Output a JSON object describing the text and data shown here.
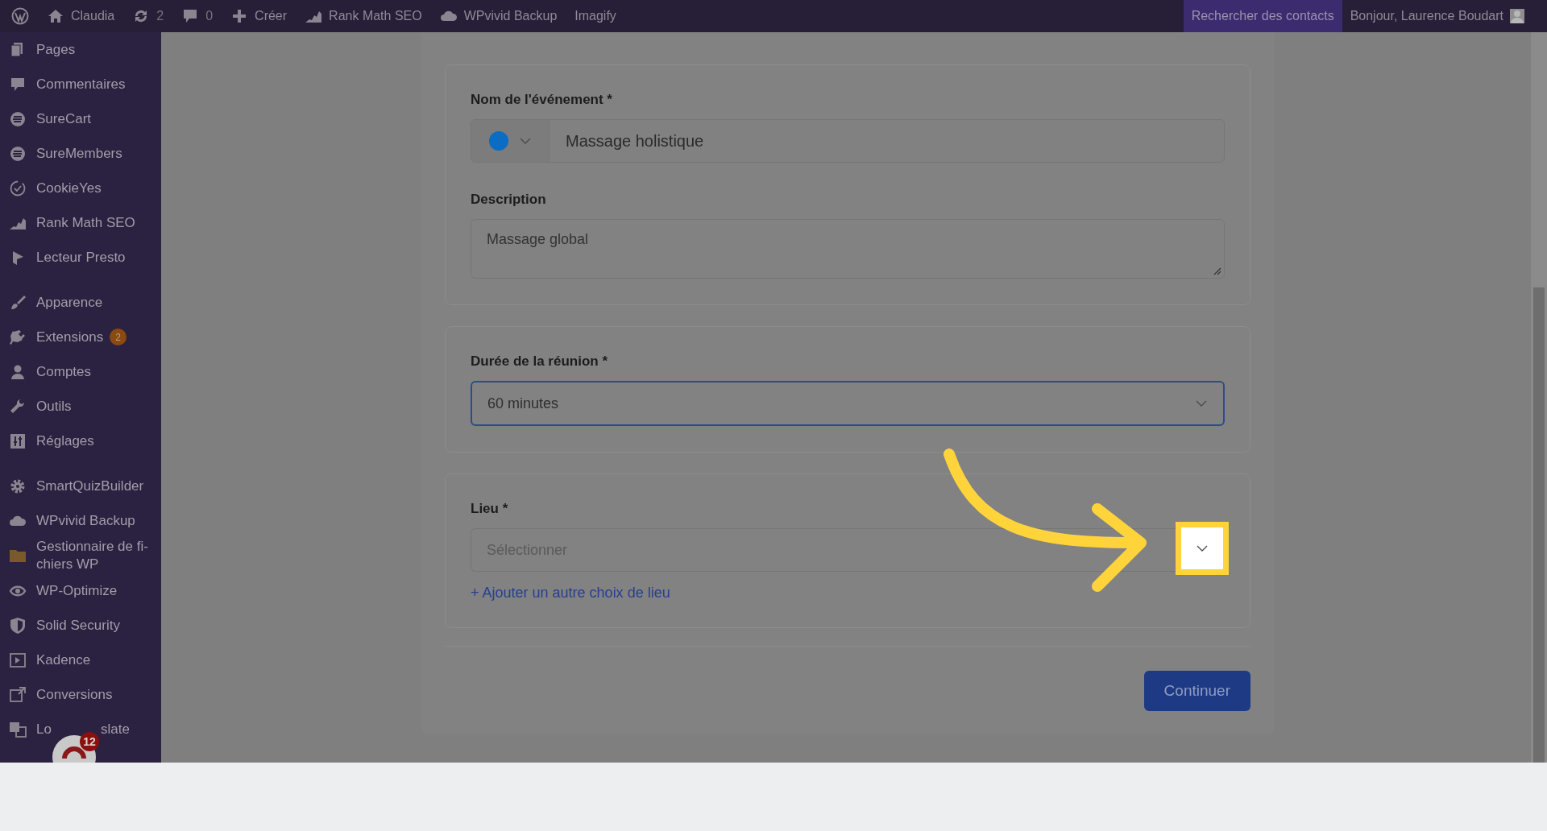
{
  "admin_bar": {
    "items": [
      {
        "label": "Claudia"
      },
      {
        "label": "2"
      },
      {
        "label": "0"
      },
      {
        "label": "Créer"
      },
      {
        "label": "Rank Math SEO"
      },
      {
        "label": "WPvivid Backup"
      },
      {
        "label": "Imagify"
      }
    ],
    "search_contacts": "Rechercher des contacts",
    "greeting": "Bonjour, Laurence Boudart"
  },
  "sidebar": {
    "groups": [
      [
        {
          "label": "Pages"
        },
        {
          "label": "Commentaires"
        },
        {
          "label": "SureCart"
        },
        {
          "label": "SureMembers"
        },
        {
          "label": "CookieYes"
        },
        {
          "label": "Rank Math SEO"
        },
        {
          "label": "Lecteur Presto"
        }
      ],
      [
        {
          "label": "Apparence"
        },
        {
          "label": "Extensions",
          "badge": "2"
        },
        {
          "label": "Comptes"
        },
        {
          "label": "Outils"
        },
        {
          "label": "Réglages"
        }
      ],
      [
        {
          "label": "SmartQuizBuilder"
        },
        {
          "label": "WPvivid Backup"
        },
        {
          "label": "Gestionnaire de fi-\nchiers WP"
        },
        {
          "label": "WP-Optimize"
        },
        {
          "label": "Solid Security"
        },
        {
          "label": "Kadence"
        },
        {
          "label": "Conversions"
        },
        {
          "label_parts": [
            "Lo",
            "slate"
          ]
        }
      ]
    ]
  },
  "floating_widget": {
    "badge": "12"
  },
  "form": {
    "sections": [
      {
        "fields": [
          {
            "kind": "name",
            "label": "Nom de l'événement *",
            "value": "Massage holistique",
            "color": "#0a6cc2"
          },
          {
            "kind": "textarea",
            "label": "Description",
            "value": "Massage global"
          }
        ]
      },
      {
        "fields": [
          {
            "kind": "select",
            "label": "Durée de la réunion *",
            "value": "60 minutes",
            "focused": true
          }
        ]
      },
      {
        "fields": [
          {
            "kind": "select",
            "label": "Lieu *",
            "placeholder": "Sélectionner",
            "focused": false,
            "highlighted": true
          }
        ],
        "link": "+ Ajouter un autre choix de lieu"
      }
    ],
    "button": "Continuer"
  }
}
